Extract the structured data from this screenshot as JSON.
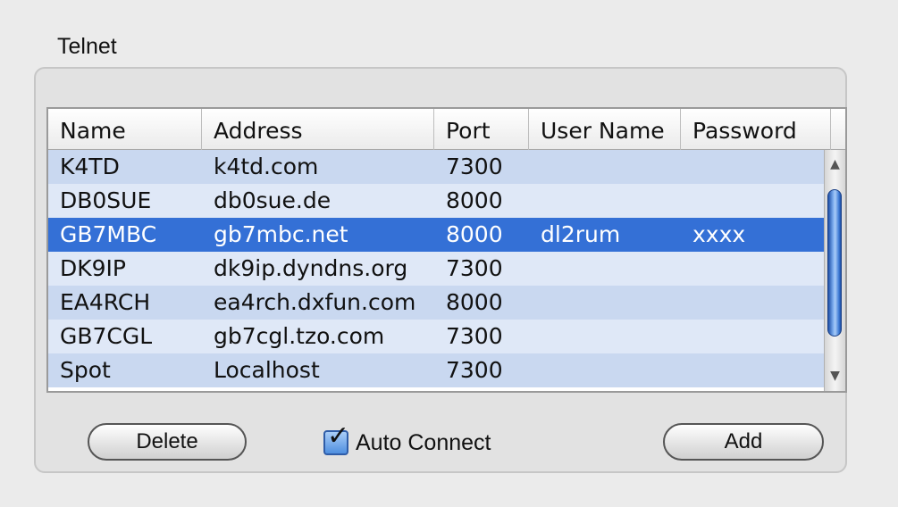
{
  "group": {
    "title": "Telnet"
  },
  "table": {
    "columns": [
      "Name",
      "Address",
      "Port",
      "User Name",
      "Password"
    ],
    "rows": [
      {
        "name": "K4TD",
        "address": "k4td.com",
        "port": "7300",
        "user": "",
        "password": ""
      },
      {
        "name": "DB0SUE",
        "address": "db0sue.de",
        "port": "8000",
        "user": "",
        "password": ""
      },
      {
        "name": "GB7MBC",
        "address": "gb7mbc.net",
        "port": "8000",
        "user": "dl2rum",
        "password": "xxxx"
      },
      {
        "name": "DK9IP",
        "address": "dk9ip.dyndns.org",
        "port": "7300",
        "user": "",
        "password": ""
      },
      {
        "name": "EA4RCH",
        "address": "ea4rch.dxfun.com",
        "port": "8000",
        "user": "",
        "password": ""
      },
      {
        "name": "GB7CGL",
        "address": "gb7cgl.tzo.com",
        "port": "7300",
        "user": "",
        "password": ""
      },
      {
        "name": "Spot",
        "address": "Localhost",
        "port": "7300",
        "user": "",
        "password": ""
      }
    ],
    "selected_row_index": 2
  },
  "buttons": {
    "delete_label": "Delete",
    "add_label": "Add"
  },
  "auto_connect": {
    "label": "Auto Connect",
    "checked": true
  },
  "colors": {
    "selection": "#3470d6",
    "row_odd": "#c9d8f0",
    "row_even": "#dfe8f7",
    "scroll_thumb": "#3d7ad4"
  }
}
